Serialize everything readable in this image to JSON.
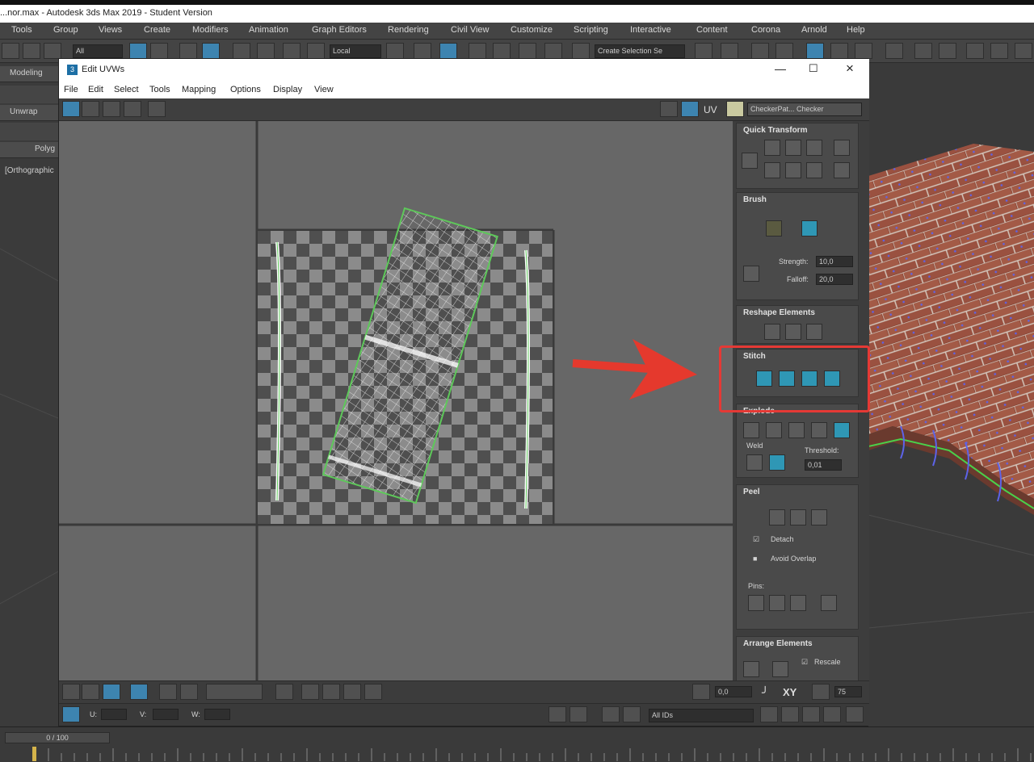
{
  "app": {
    "title": "...nor.max - Autodesk 3ds Max 2019 - Student Version"
  },
  "main_menu": [
    "Tools",
    "Group",
    "Views",
    "Create",
    "Modifiers",
    "Animation",
    "Graph Editors",
    "Rendering",
    "Civil View",
    "Customize",
    "Scripting",
    "Interactive",
    "Content",
    "Corona",
    "Arnold",
    "Help"
  ],
  "main_toolbar": {
    "filter_value": "All",
    "coord_value": "Local",
    "selection_set_placeholder": "Create Selection Se"
  },
  "left_panel": {
    "tab_modeling": "Modeling",
    "tab_unwrap": "Unwrap",
    "tab_polygon": "Polyg",
    "viewport_label": "[Orthographic"
  },
  "edit_uvws": {
    "title": "Edit UVWs",
    "title_icon": "3",
    "window_controls": {
      "minimize": "—",
      "maximize": "☐",
      "close": "×"
    },
    "menu": [
      "File",
      "Edit",
      "Select",
      "Tools",
      "Mapping",
      "Options",
      "Display",
      "View"
    ],
    "toolbar": {
      "uv_label": "UV",
      "checker_select": "CheckerPat... Checker"
    },
    "rollouts": {
      "quick_transform": {
        "title": "Quick Transform"
      },
      "brush": {
        "title": "Brush",
        "strength_label": "Strength:",
        "strength_value": "10,0",
        "falloff_label": "Falloff:",
        "falloff_value": "20,0"
      },
      "reshape": {
        "title": "Reshape Elements"
      },
      "stitch": {
        "title": "Stitch"
      },
      "explode": {
        "title": "Explode",
        "weld_label": "Weld",
        "threshold_label": "Threshold:",
        "threshold_value": "0,01"
      },
      "peel": {
        "title": "Peel",
        "detach_label": "Detach",
        "avoid_overlap_label": "Avoid Overlap",
        "pins_label": "Pins:"
      },
      "arrange": {
        "title": "Arrange Elements",
        "rescale_label": "Rescale"
      }
    },
    "bottom_toolbar": {
      "rotate_value": "0,0",
      "xy_label": "XY",
      "zoom_value": "75",
      "u_label": "U:",
      "v_label": "V:",
      "w_label": "W:",
      "all_ids_value": "All IDs"
    }
  },
  "timeline": {
    "frame_display": "0 / 100"
  },
  "colors": {
    "accent_blue": "#3d84b0",
    "teal_icon": "#2f97b5",
    "uv_wire": "#5ec85a",
    "callout_red": "#e53935"
  }
}
